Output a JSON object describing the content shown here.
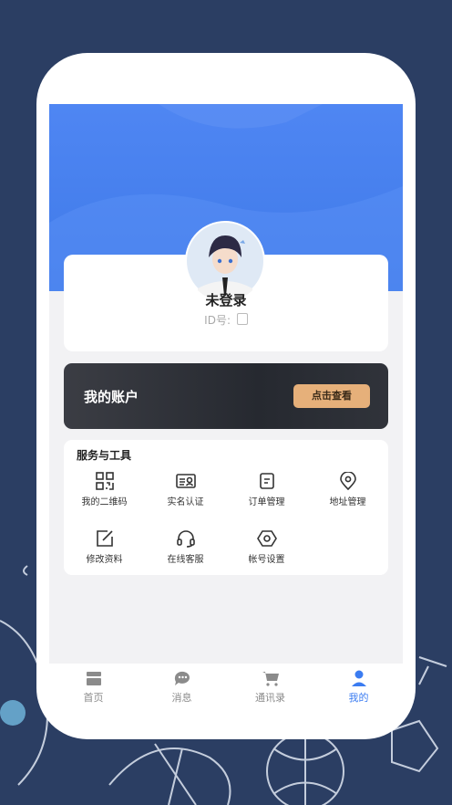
{
  "profile": {
    "name": "未登录",
    "id_label": "ID号:"
  },
  "account": {
    "title": "我的账户",
    "button": "点击查看"
  },
  "tools": {
    "title": "服务与工具",
    "items": [
      {
        "label": "我的二维码",
        "icon": "qr-code-icon"
      },
      {
        "label": "实名认证",
        "icon": "id-card-icon"
      },
      {
        "label": "订单管理",
        "icon": "order-icon"
      },
      {
        "label": "地址管理",
        "icon": "location-icon"
      },
      {
        "label": "修改资料",
        "icon": "edit-icon"
      },
      {
        "label": "在线客服",
        "icon": "headset-icon"
      },
      {
        "label": "帐号设置",
        "icon": "settings-icon"
      }
    ]
  },
  "tabbar": {
    "items": [
      {
        "label": "首页",
        "icon": "home-icon"
      },
      {
        "label": "消息",
        "icon": "message-icon"
      },
      {
        "label": "通讯录",
        "icon": "cart-icon"
      },
      {
        "label": "我的",
        "icon": "user-icon"
      }
    ],
    "active": "我的"
  },
  "colors": {
    "accent": "#3b7cf1",
    "gold": "#e6b07a",
    "background": "#2b3e63"
  }
}
